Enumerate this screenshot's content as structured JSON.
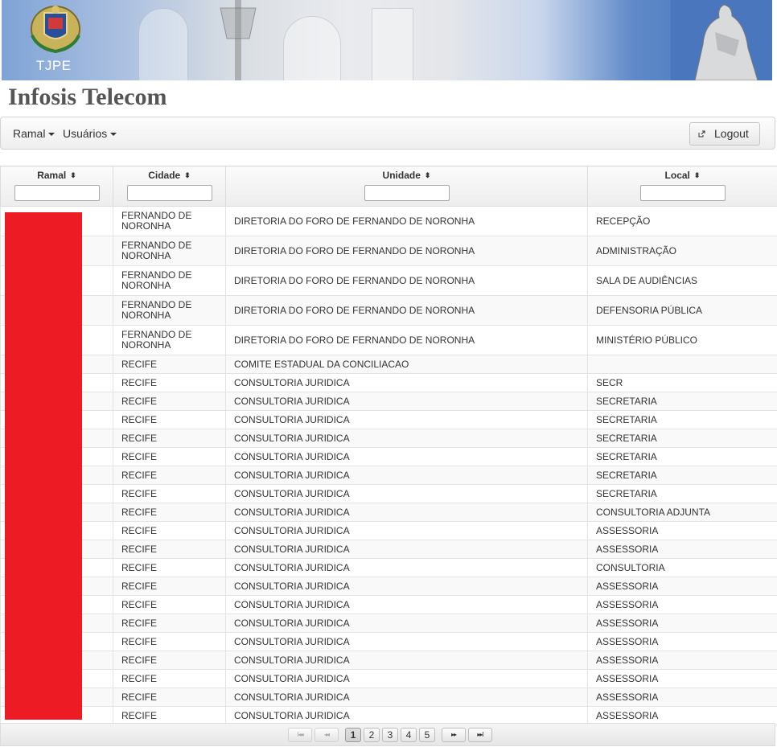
{
  "banner": {
    "logo_text": "TJPE"
  },
  "app": {
    "title": "Infosis Telecom"
  },
  "menu": {
    "ramal": "Ramal",
    "usuarios": "Usuários",
    "logout": "Logout"
  },
  "table": {
    "columns": [
      "Ramal",
      "Cidade",
      "Unidade",
      "Local"
    ],
    "rows": [
      {
        "ramal": "",
        "cidade": "FERNANDO DE NORONHA",
        "unidade": "DIRETORIA DO FORO DE FERNANDO DE NORONHA",
        "local": "RECEPÇÃO"
      },
      {
        "ramal": "",
        "cidade": "FERNANDO DE NORONHA",
        "unidade": "DIRETORIA DO FORO DE FERNANDO DE NORONHA",
        "local": "ADMINISTRAÇÃO"
      },
      {
        "ramal": "",
        "cidade": "FERNANDO DE NORONHA",
        "unidade": "DIRETORIA DO FORO DE FERNANDO DE NORONHA",
        "local": "SALA DE AUDIÊNCIAS"
      },
      {
        "ramal": "",
        "cidade": "FERNANDO DE NORONHA",
        "unidade": "DIRETORIA DO FORO DE FERNANDO DE NORONHA",
        "local": "DEFENSORIA PÚBLICA"
      },
      {
        "ramal": "",
        "cidade": "FERNANDO DE NORONHA",
        "unidade": "DIRETORIA DO FORO DE FERNANDO DE NORONHA",
        "local": "MINISTÉRIO PÚBLICO"
      },
      {
        "ramal": "",
        "cidade": "RECIFE",
        "unidade": "COMITE ESTADUAL DA CONCILIACAO",
        "local": ""
      },
      {
        "ramal": "",
        "cidade": "RECIFE",
        "unidade": "CONSULTORIA JURIDICA",
        "local": "SECR"
      },
      {
        "ramal": "",
        "cidade": "RECIFE",
        "unidade": "CONSULTORIA JURIDICA",
        "local": "SECRETARIA"
      },
      {
        "ramal": "",
        "cidade": "RECIFE",
        "unidade": "CONSULTORIA JURIDICA",
        "local": "SECRETARIA"
      },
      {
        "ramal": "",
        "cidade": "RECIFE",
        "unidade": "CONSULTORIA JURIDICA",
        "local": "SECRETARIA"
      },
      {
        "ramal": "",
        "cidade": "RECIFE",
        "unidade": "CONSULTORIA JURIDICA",
        "local": "SECRETARIA"
      },
      {
        "ramal": "",
        "cidade": "RECIFE",
        "unidade": "CONSULTORIA JURIDICA",
        "local": "SECRETARIA"
      },
      {
        "ramal": "",
        "cidade": "RECIFE",
        "unidade": "CONSULTORIA JURIDICA",
        "local": "SECRETARIA"
      },
      {
        "ramal": "",
        "cidade": "RECIFE",
        "unidade": "CONSULTORIA JURIDICA",
        "local": "CONSULTORIA ADJUNTA"
      },
      {
        "ramal": "",
        "cidade": "RECIFE",
        "unidade": "CONSULTORIA JURIDICA",
        "local": "ASSESSORIA"
      },
      {
        "ramal": "",
        "cidade": "RECIFE",
        "unidade": "CONSULTORIA JURIDICA",
        "local": "ASSESSORIA"
      },
      {
        "ramal": "",
        "cidade": "RECIFE",
        "unidade": "CONSULTORIA JURIDICA",
        "local": "CONSULTORIA"
      },
      {
        "ramal": "",
        "cidade": "RECIFE",
        "unidade": "CONSULTORIA JURIDICA",
        "local": "ASSESSORIA"
      },
      {
        "ramal": "",
        "cidade": "RECIFE",
        "unidade": "CONSULTORIA JURIDICA",
        "local": "ASSESSORIA"
      },
      {
        "ramal": "",
        "cidade": "RECIFE",
        "unidade": "CONSULTORIA JURIDICA",
        "local": "ASSESSORIA"
      },
      {
        "ramal": "",
        "cidade": "RECIFE",
        "unidade": "CONSULTORIA JURIDICA",
        "local": "ASSESSORIA"
      },
      {
        "ramal": "",
        "cidade": "RECIFE",
        "unidade": "CONSULTORIA JURIDICA",
        "local": "ASSESSORIA"
      },
      {
        "ramal": "",
        "cidade": "RECIFE",
        "unidade": "CONSULTORIA JURIDICA",
        "local": "ASSESSORIA"
      },
      {
        "ramal": "",
        "cidade": "RECIFE",
        "unidade": "CONSULTORIA JURIDICA",
        "local": "ASSESSORIA"
      },
      {
        "ramal": "",
        "cidade": "RECIFE",
        "unidade": "CONSULTORIA JURIDICA",
        "local": "ASSESSORIA"
      }
    ]
  },
  "paginator": {
    "first": "I◂◂",
    "prev": "◂◂",
    "pages": [
      "1",
      "2",
      "3",
      "4",
      "5"
    ],
    "current_page": "1",
    "next": "▸▸",
    "last": "▸▸I"
  },
  "colors": {
    "redaction": "#ed1c24",
    "banner_blue": "#3f6fb8",
    "title_gray": "#555555"
  }
}
